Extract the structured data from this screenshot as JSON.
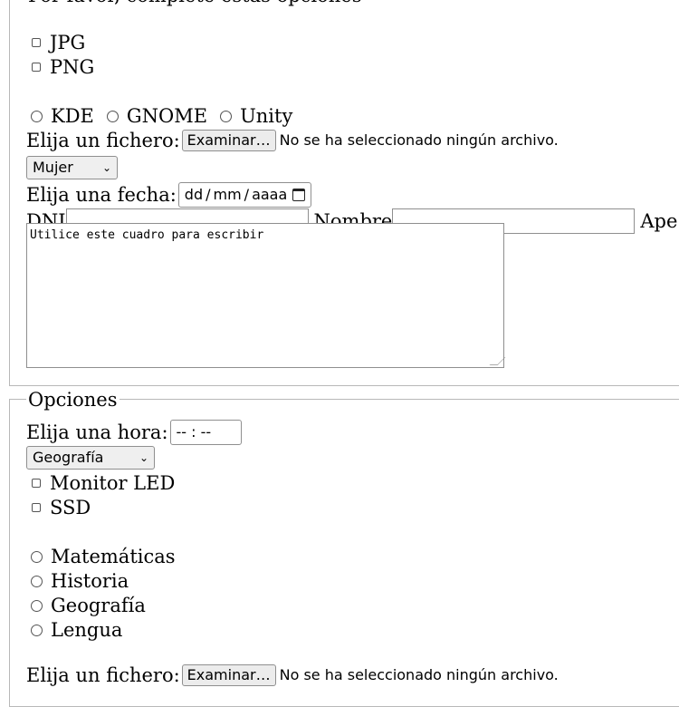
{
  "section1": {
    "legend": "Por favor, complete estas opciones",
    "checkboxes": [
      "JPG",
      "PNG"
    ],
    "radios": [
      "KDE",
      "GNOME",
      "Unity"
    ],
    "file": {
      "label": "Elija un fichero:",
      "button": "Examinar…",
      "status": "No se ha seleccionado ningún archivo."
    },
    "gender_select": "Mujer",
    "date": {
      "label": "Elija una fecha:",
      "dd": "dd",
      "mm": "mm",
      "yyyy": "aaaa"
    },
    "text_fields": {
      "dni": "DNI",
      "nombre": "Nombre",
      "apellidos": "Ape"
    },
    "textarea": "Utilice este cuadro para escribir"
  },
  "section2": {
    "legend": "Opciones",
    "time": {
      "label": "Elija una hora:",
      "value": "-- : --"
    },
    "subject_select": "Geografía",
    "checkboxes": [
      "Monitor LED",
      "SSD"
    ],
    "radios": [
      "Matemáticas",
      "Historia",
      "Geografía",
      "Lengua"
    ],
    "file": {
      "label": "Elija un fichero:",
      "button": "Examinar…",
      "status": "No se ha seleccionado ningún archivo."
    }
  }
}
